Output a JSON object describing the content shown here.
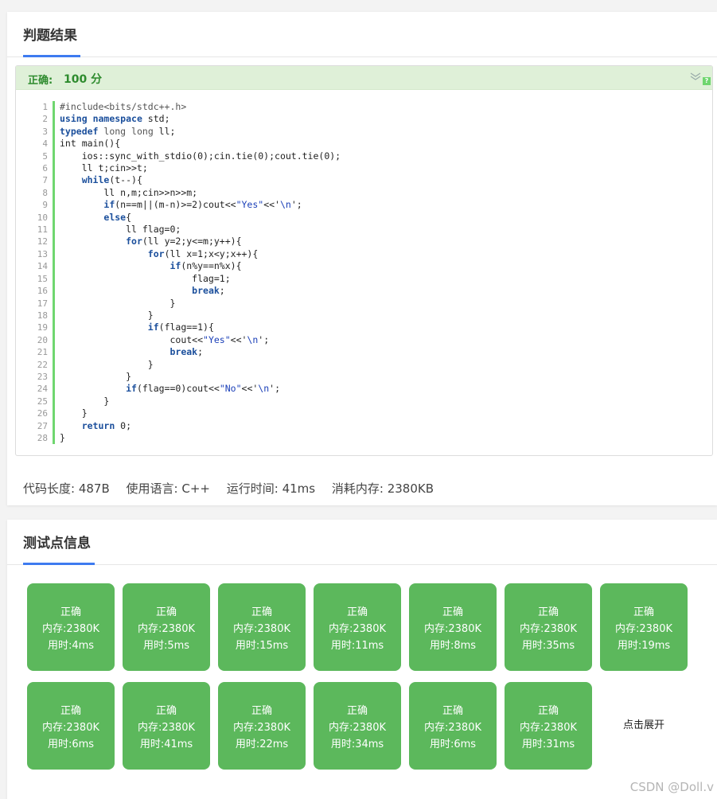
{
  "judge": {
    "title": "判题结果",
    "result_label": "正确:",
    "result_score": "100 分",
    "code_lines": [
      "#include<bits/stdc++.h>",
      "using namespace std;",
      "typedef long long ll;",
      "int main(){",
      "    ios::sync_with_stdio(0);cin.tie(0);cout.tie(0);",
      "    ll t;cin>>t;",
      "    while(t--){",
      "        ll n,m;cin>>n>>m;",
      "        if(n==m||(m-n)>=2)cout<<\"Yes\"<<'\\n';",
      "        else{",
      "            ll flag=0;",
      "            for(ll y=2;y<=m;y++){",
      "                for(ll x=1;x<y;x++){",
      "                    if(n%y==n%x){",
      "                        flag=1;",
      "                        break;",
      "                    }",
      "                }",
      "                if(flag==1){",
      "                    cout<<\"Yes\"<<'\\n';",
      "                    break;",
      "                }",
      "            }",
      "            if(flag==0)cout<<\"No\"<<'\\n';",
      "        }",
      "    }",
      "    return 0;",
      "}"
    ],
    "help_badge": "?",
    "stats": {
      "code_length": "代码长度: 487B",
      "language": "使用语言: C++",
      "runtime": "运行时间: 41ms",
      "memory": "消耗内存: 2380KB"
    }
  },
  "testpoints": {
    "title": "测试点信息",
    "items": [
      {
        "status": "正确",
        "memory": "内存:2380K",
        "time": "用时:4ms"
      },
      {
        "status": "正确",
        "memory": "内存:2380K",
        "time": "用时:5ms"
      },
      {
        "status": "正确",
        "memory": "内存:2380K",
        "time": "用时:15ms"
      },
      {
        "status": "正确",
        "memory": "内存:2380K",
        "time": "用时:11ms"
      },
      {
        "status": "正确",
        "memory": "内存:2380K",
        "time": "用时:8ms"
      },
      {
        "status": "正确",
        "memory": "内存:2380K",
        "time": "用时:35ms"
      },
      {
        "status": "正确",
        "memory": "内存:2380K",
        "time": "用时:19ms"
      },
      {
        "status": "正确",
        "memory": "内存:2380K",
        "time": "用时:6ms"
      },
      {
        "status": "正确",
        "memory": "内存:2380K",
        "time": "用时:41ms"
      },
      {
        "status": "正确",
        "memory": "内存:2380K",
        "time": "用时:22ms"
      },
      {
        "status": "正确",
        "memory": "内存:2380K",
        "time": "用时:34ms"
      },
      {
        "status": "正确",
        "memory": "内存:2380K",
        "time": "用时:6ms"
      },
      {
        "status": "正确",
        "memory": "内存:2380K",
        "time": "用时:31ms"
      }
    ],
    "expand_label": "点击展开"
  },
  "watermark": "CSDN @Doll.v",
  "colors": {
    "accent": "#3e7bf0",
    "success": "#5cb85c",
    "success_bg": "#dff0d8"
  }
}
